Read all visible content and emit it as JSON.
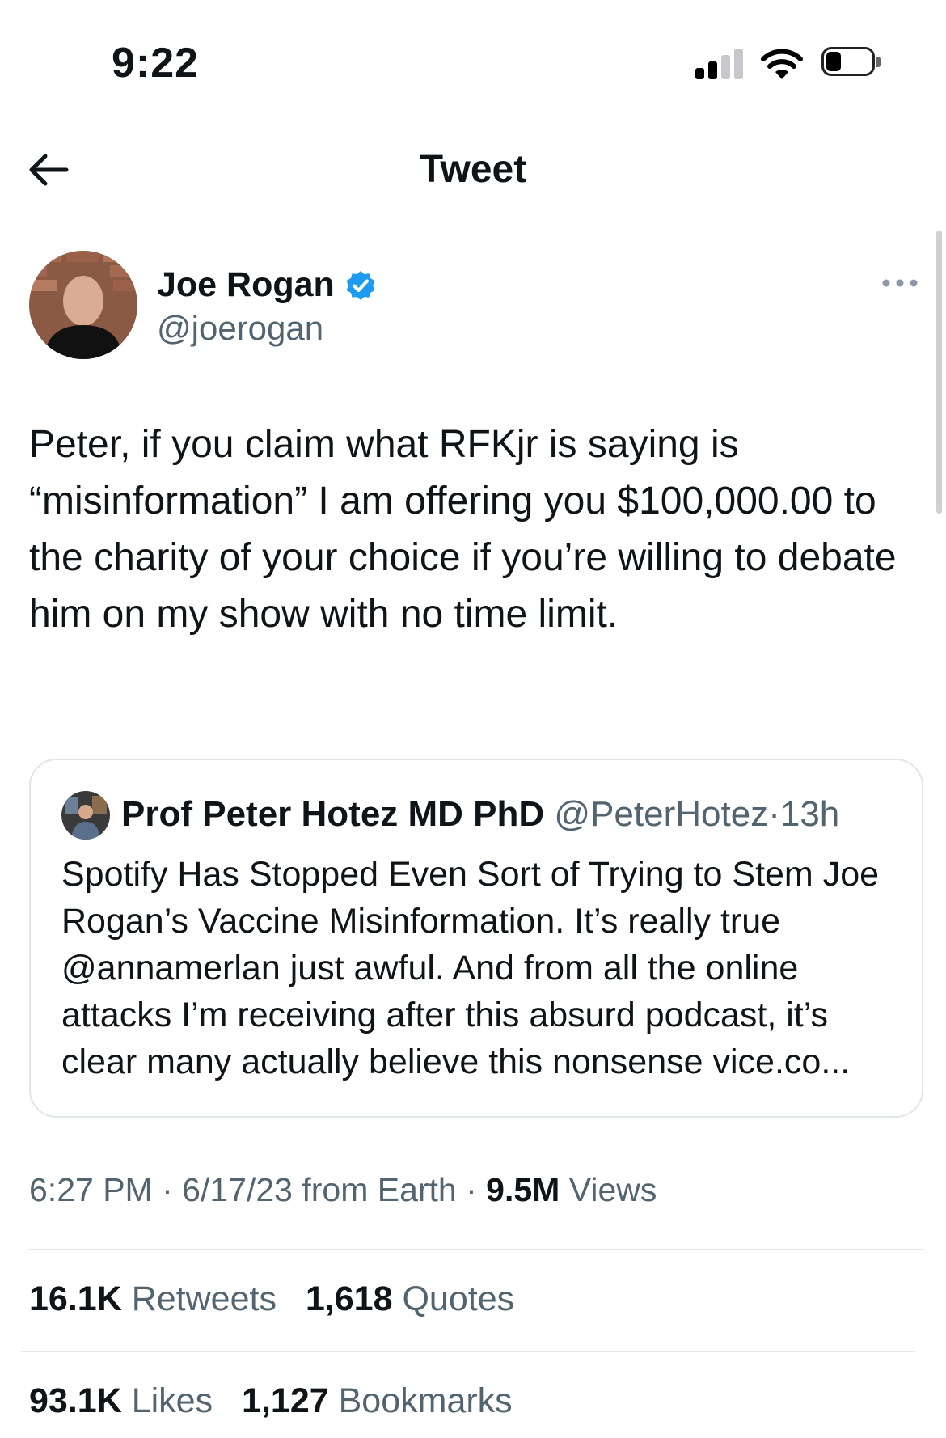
{
  "status_bar": {
    "time": "9:22",
    "signal_bars_active": 2,
    "signal_bars_total": 4,
    "battery_level_fraction": 0.3
  },
  "nav": {
    "back_icon": "arrow-left-icon",
    "title": "Tweet"
  },
  "tweet": {
    "author": {
      "display_name": "Joe Rogan",
      "handle": "@joerogan",
      "verified": true,
      "verified_color": "#1d9bf0"
    },
    "text": "Peter, if you claim what RFKjr is saying is “misinformation” I am offering you $100,000.00 to the charity of your choice if you’re willing to debate him on my show with no time limit.",
    "quoted_tweet": {
      "author_name": "Prof Peter Hotez MD PhD",
      "author_handle": "@PeterHotez",
      "separator": "·",
      "age": "13h",
      "text": "Spotify Has Stopped Even Sort of Trying to Stem Joe Rogan’s Vaccine Misinformation. It’s really true @annamerlan just awful. And from all the online attacks I’m receiving after this absurd podcast, it’s clear many actually believe this nonsense vice.co..."
    },
    "meta": {
      "time": "6:27 PM",
      "date": "6/17/23",
      "source": "from Earth",
      "views_count": "9.5M",
      "views_label": "Views"
    },
    "stats": {
      "retweets_count": "16.1K",
      "retweets_label": "Retweets",
      "quotes_count": "1,618",
      "quotes_label": "Quotes",
      "likes_count": "93.1K",
      "likes_label": "Likes",
      "bookmarks_count": "1,127",
      "bookmarks_label": "Bookmarks"
    }
  },
  "colors": {
    "text_primary": "#0f1419",
    "text_secondary": "#536471",
    "border": "#e1e6ea",
    "accent": "#1d9bf0"
  }
}
